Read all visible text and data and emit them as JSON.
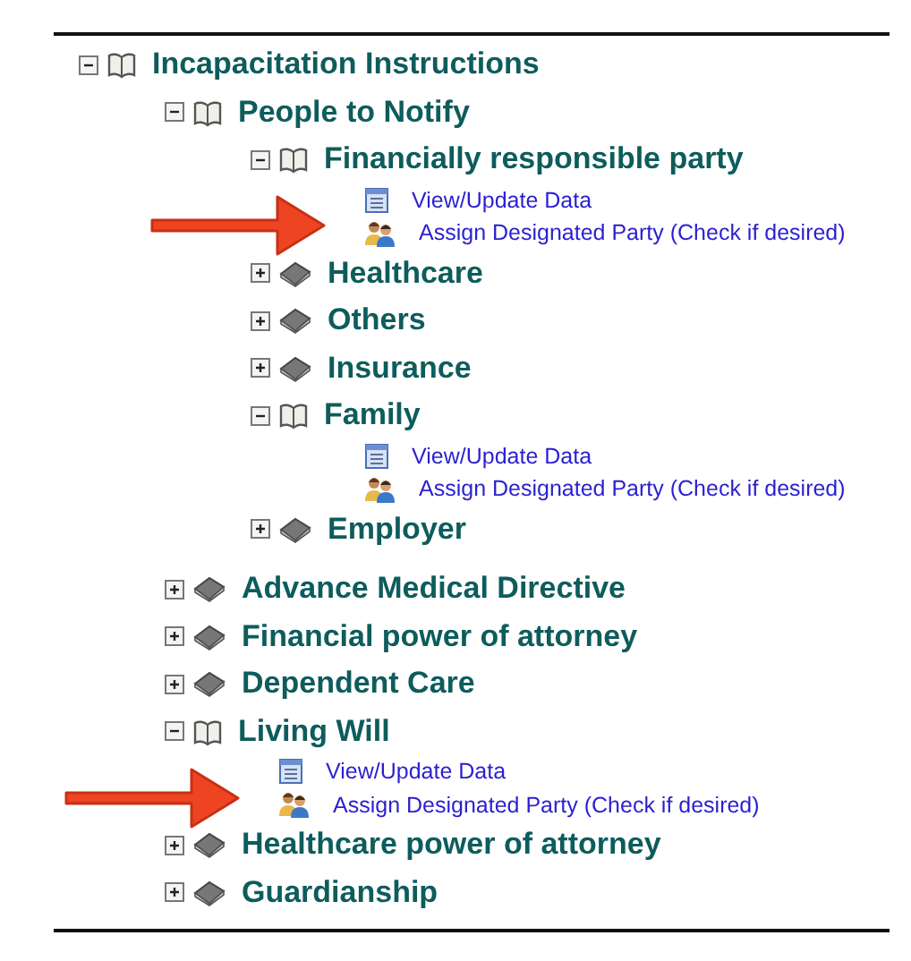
{
  "tree": [
    {
      "label": "Incapacitation Instructions",
      "expanded": true,
      "children": [
        {
          "label": "People to Notify",
          "expanded": true,
          "children": [
            {
              "label": "Financially responsible party",
              "expanded": true,
              "children": [
                {
                  "kind": "data",
                  "label": "View/Update Data",
                  "arrow": false
                },
                {
                  "kind": "assign",
                  "label": "Assign Designated Party (Check if desired)",
                  "arrow": true
                }
              ]
            },
            {
              "label": "Healthcare",
              "expanded": false
            },
            {
              "label": "Others",
              "expanded": false
            },
            {
              "label": "Insurance",
              "expanded": false
            },
            {
              "label": "Family",
              "expanded": true,
              "children": [
                {
                  "kind": "data",
                  "label": "View/Update Data",
                  "arrow": false
                },
                {
                  "kind": "assign",
                  "label": "Assign Designated Party (Check if desired)",
                  "arrow": false
                }
              ]
            },
            {
              "label": "Employer",
              "expanded": false
            }
          ]
        },
        {
          "label": "Advance Medical Directive",
          "expanded": false
        },
        {
          "label": "Financial power of attorney",
          "expanded": false
        },
        {
          "label": "Dependent Care",
          "expanded": false
        },
        {
          "label": "Living Will",
          "expanded": true,
          "children": [
            {
              "kind": "data",
              "label": "View/Update Data",
              "arrow": false
            },
            {
              "kind": "assign",
              "label": "Assign Designated Party (Check if desired)",
              "arrow": true
            }
          ]
        },
        {
          "label": "Healthcare power of attorney",
          "expanded": false
        },
        {
          "label": "Guardianship",
          "expanded": false
        }
      ]
    }
  ]
}
